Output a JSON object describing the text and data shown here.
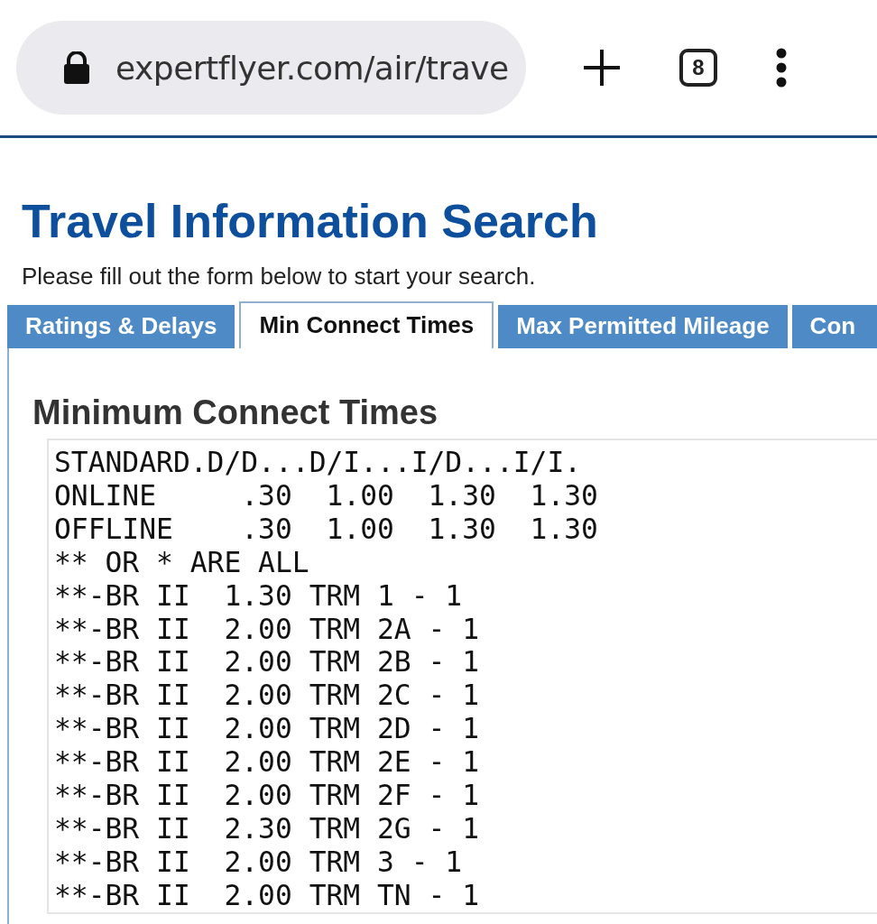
{
  "browser": {
    "url": "expertflyer.com/air/trave",
    "tab_count": "8"
  },
  "page": {
    "title": "Travel Information Search",
    "subtitle": "Please fill out the form below to start your search."
  },
  "tabs": [
    {
      "label": "Ratings & Delays",
      "selected": false
    },
    {
      "label": "Min Connect Times",
      "selected": true
    },
    {
      "label": "Max Permitted Mileage",
      "selected": false
    },
    {
      "label": "Con",
      "selected": false
    }
  ],
  "panel": {
    "heading": "Minimum Connect Times",
    "lines": [
      "STANDARD.D/D...D/I...I/D...I/I.",
      "ONLINE     .30  1.00  1.30  1.30",
      "OFFLINE    .30  1.00  1.30  1.30",
      "** OR * ARE ALL",
      "**-BR II  1.30 TRM 1 - 1",
      "**-BR II  2.00 TRM 2A - 1",
      "**-BR II  2.00 TRM 2B - 1",
      "**-BR II  2.00 TRM 2C - 1",
      "**-BR II  2.00 TRM 2D - 1",
      "**-BR II  2.00 TRM 2E - 1",
      "**-BR II  2.00 TRM 2F - 1",
      "**-BR II  2.30 TRM 2G - 1",
      "**-BR II  2.00 TRM 3 - 1",
      "**-BR II  2.00 TRM TN - 1"
    ]
  }
}
